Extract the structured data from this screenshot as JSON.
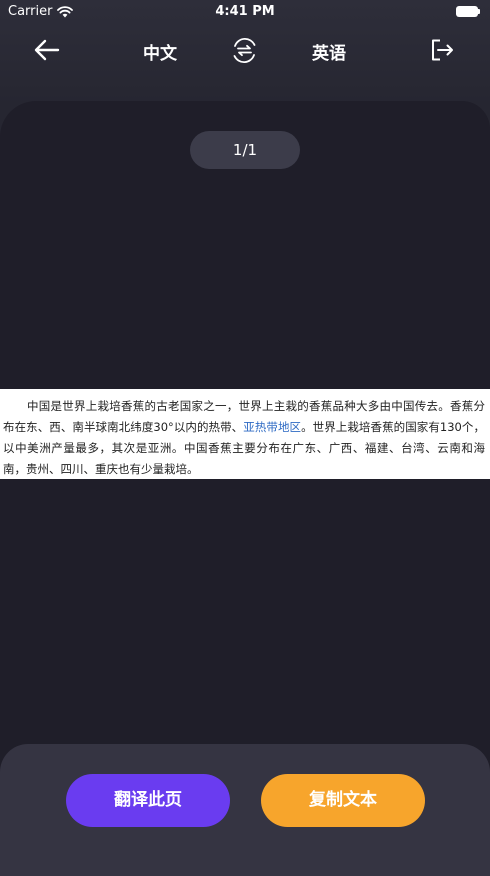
{
  "status_bar": {
    "carrier": "Carrier",
    "time": "4:41 PM"
  },
  "header": {
    "source_language": "中文",
    "target_language": "英语",
    "icons": {
      "back": "arrow-left-icon",
      "swap": "swap-languages-icon",
      "exit": "logout-icon"
    }
  },
  "content": {
    "page_indicator": "1/1",
    "document": {
      "text_before_link": "中国是世界上栽培香蕉的古老国家之一，世界上主栽的香蕉品种大多由中国传去。香蕉分布在东、西、南半球南北纬度30°以内的热带、",
      "link_text": "亚热带地区",
      "text_after_link": "。世界上栽培香蕉的国家有130个，以中美洲产量最多，其次是亚洲。中国香蕉主要分布在广东、广西、福建、台湾、云南和海南，贵州、四川、重庆也有少量栽培。"
    }
  },
  "actions": {
    "translate_label": "翻译此页",
    "copy_label": "复制文本"
  },
  "colors": {
    "background": "#23232d",
    "panel": "#1f1e29",
    "sheet": "#353442",
    "translate_button": "#6a3cf0",
    "copy_button": "#f7a52c",
    "link": "#2f6bc4"
  }
}
